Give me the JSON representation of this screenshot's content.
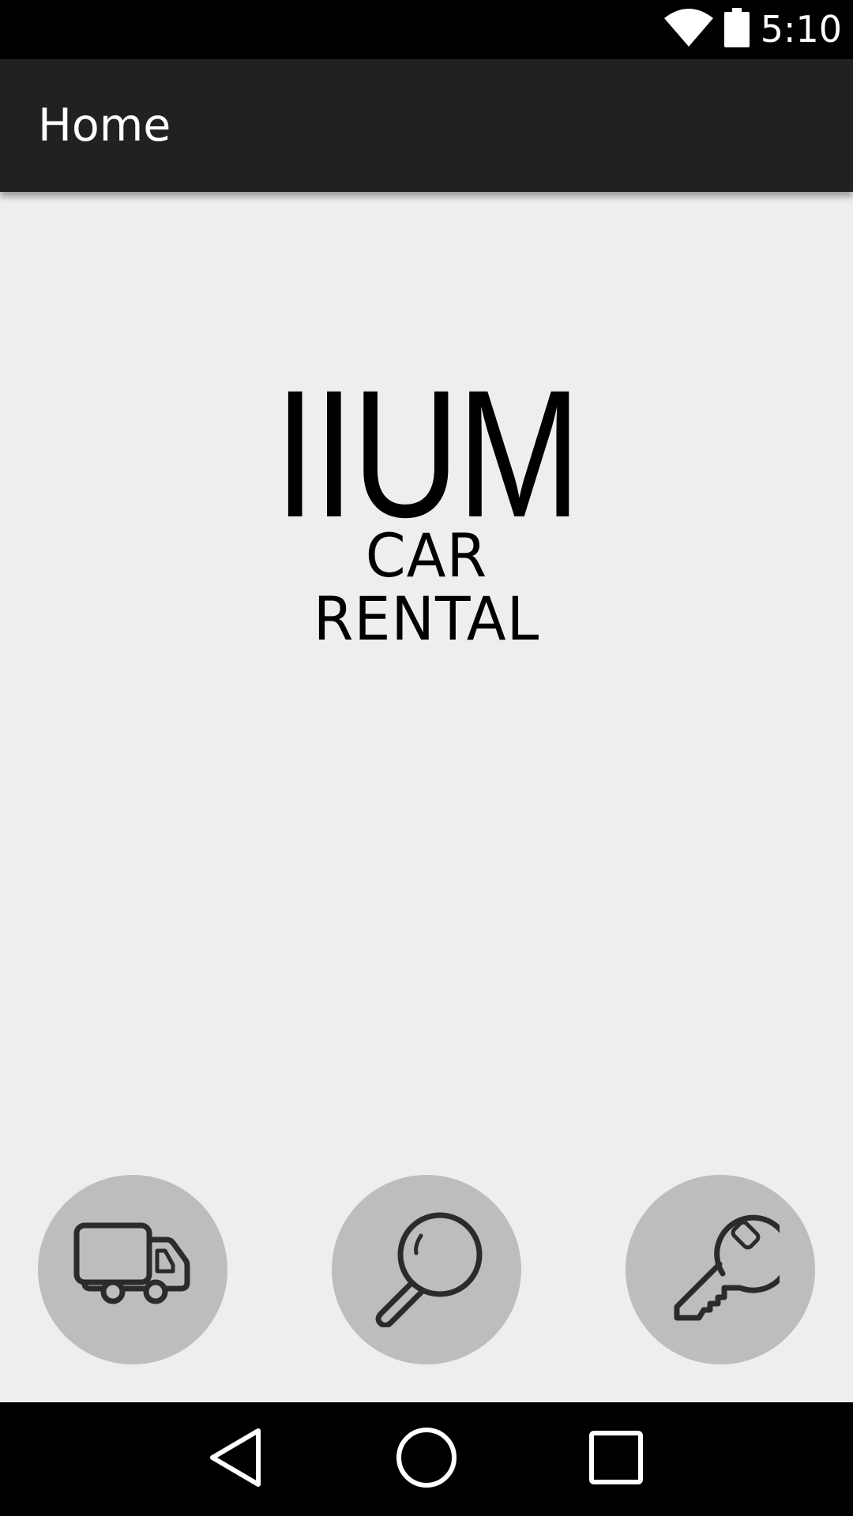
{
  "status_bar": {
    "time": "5:10",
    "icons": [
      "wifi-icon",
      "battery-icon"
    ],
    "background": "#000000"
  },
  "app_bar": {
    "title": "Home",
    "background": "#212121"
  },
  "logo": {
    "main_text": "IIUM",
    "sub_text": "CAR RENTAL"
  },
  "actions": [
    {
      "icon": "truck-icon"
    },
    {
      "icon": "magnifier-icon"
    },
    {
      "icon": "key-icon"
    }
  ],
  "navigation_bar": {
    "buttons": [
      "back-icon",
      "home-icon",
      "recents-icon"
    ]
  },
  "colors": {
    "background": "#eeeeee",
    "button_fill": "#bdbdbd",
    "icon_stroke": "#2b2b2b"
  }
}
